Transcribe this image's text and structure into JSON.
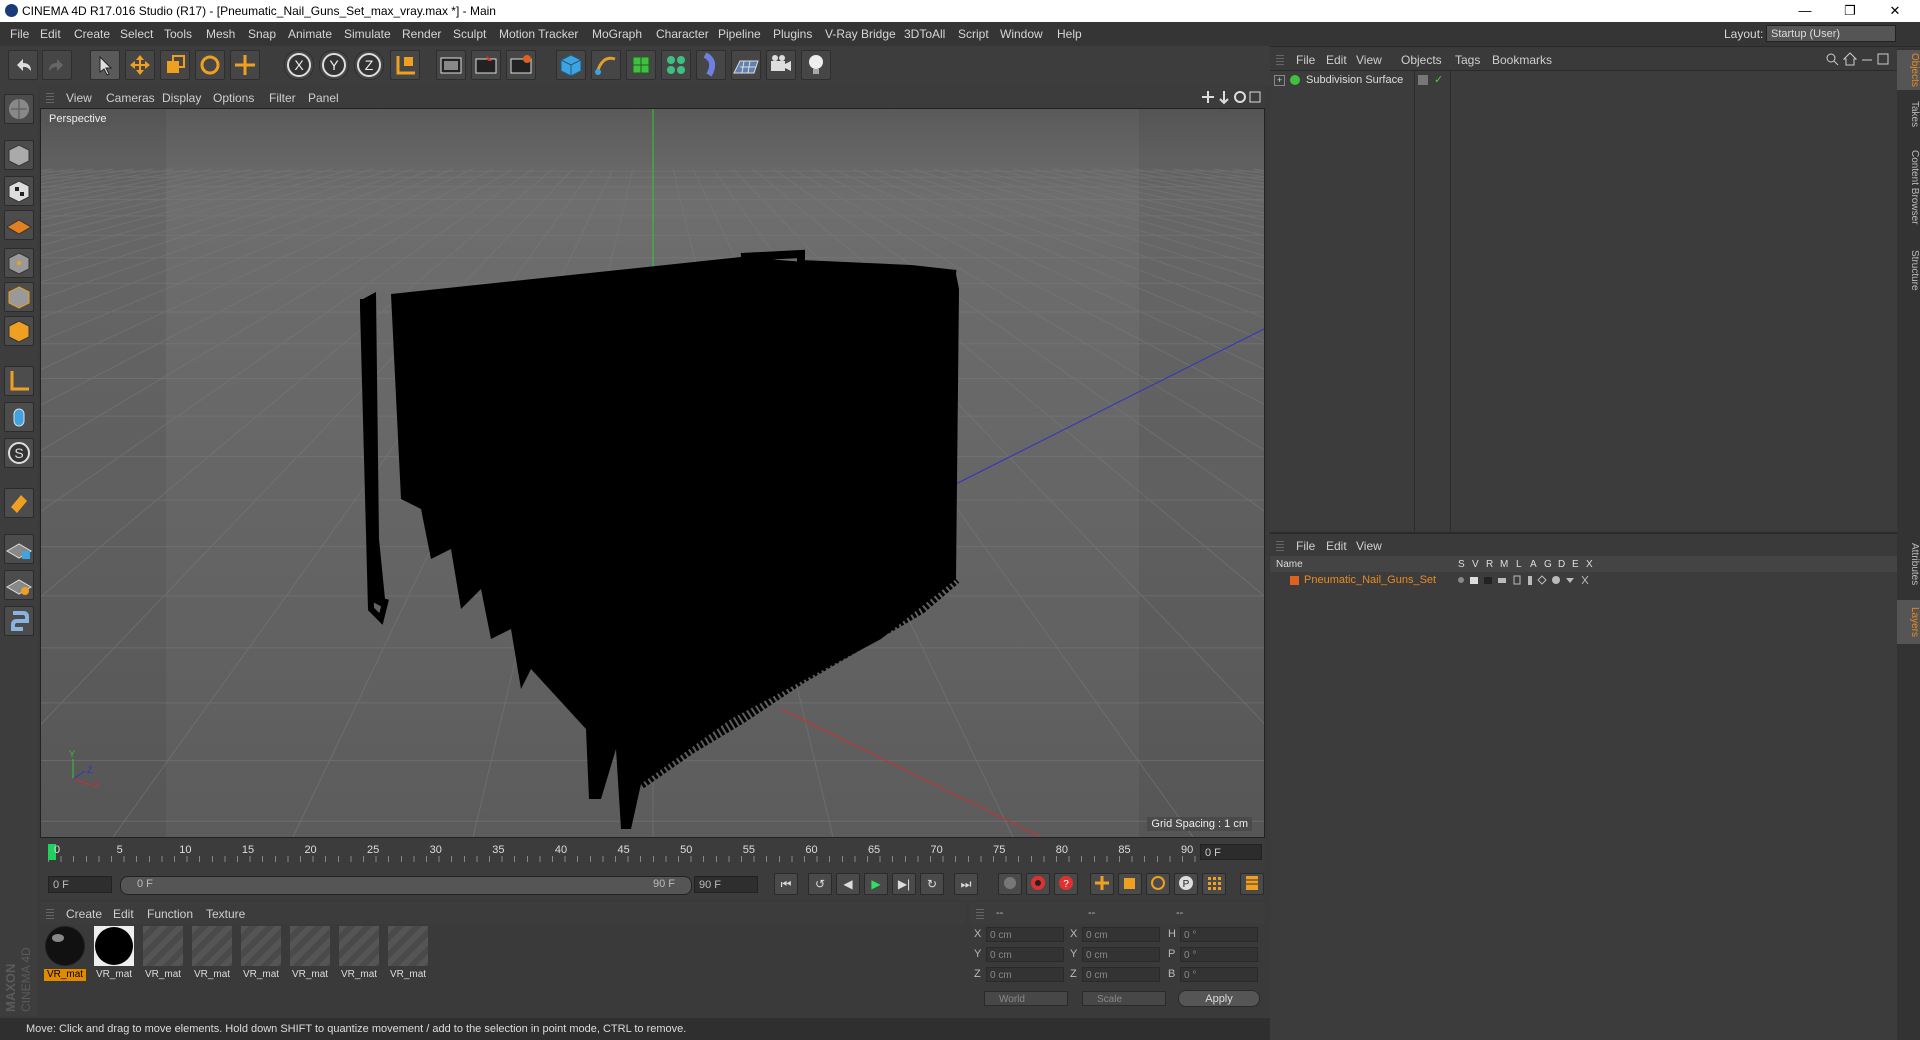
{
  "titlebar": {
    "title": "CINEMA 4D R17.016 Studio (R17) - [Pneumatic_Nail_Guns_Set_max_vray.max *] - Main",
    "minimize": "—",
    "restore": "❐",
    "close": "✕"
  },
  "menubar": {
    "items": [
      "File",
      "Edit",
      "Create",
      "Select",
      "Tools",
      "Mesh",
      "Snap",
      "Animate",
      "Simulate",
      "Render",
      "Sculpt",
      "Motion Tracker",
      "MoGraph",
      "Character",
      "Pipeline",
      "Plugins",
      "V-Ray Bridge",
      "3DToAll",
      "Script",
      "Window",
      "Help"
    ],
    "layout_label": "Layout:",
    "layout_value": "Startup (User)"
  },
  "toolbar": {
    "icons": [
      "undo-icon",
      "redo-icon",
      "select-arrow-icon",
      "move-icon",
      "scale-icon",
      "rotate-icon",
      "move-axis-icon",
      "x-axis-lock-icon",
      "y-axis-lock-icon",
      "z-axis-lock-icon",
      "coordinate-system-icon",
      "render-view-icon",
      "render-picture-viewer-icon",
      "render-settings-icon",
      "cube-primitive-icon",
      "spline-pen-icon",
      "subdivision-surface-icon",
      "mograph-cloner-icon",
      "deformer-icon",
      "floor-icon",
      "camera-icon",
      "light-icon"
    ],
    "xyz": [
      "X",
      "Y",
      "Z"
    ]
  },
  "left_toolbar": {
    "icons": [
      "make-editable-icon",
      "model-mode-icon",
      "texture-mode-icon",
      "workplane-icon",
      "points-mode-icon",
      "edges-mode-icon",
      "polygons-mode-icon",
      "axis-mode-icon",
      "tweak-mode-icon",
      "solo-mode-icon",
      "snap-icon",
      "lock-workplane-icon",
      "snap-settings-icon",
      "python-icon"
    ]
  },
  "viewport": {
    "menu": [
      "View",
      "Cameras",
      "Display",
      "Options",
      "Filter",
      "Panel"
    ],
    "label": "Perspective",
    "grid_spacing": "Grid Spacing : 1 cm",
    "axis_y": "Y",
    "axis_x": "X",
    "axis_z": "Z",
    "colors": {
      "background": "#5f5f5f",
      "floor": "#6a6a6a",
      "object": "#000000",
      "axis_x": "#c83232",
      "axis_y": "#32c832",
      "axis_z": "#3232c8"
    }
  },
  "timeline": {
    "ticks": [
      "0",
      "5",
      "10",
      "15",
      "20",
      "25",
      "30",
      "35",
      "40",
      "45",
      "50",
      "55",
      "60",
      "65",
      "70",
      "75",
      "80",
      "85",
      "90"
    ],
    "current_frame": "0 F",
    "start_field": "0 F",
    "range_start": "0 F",
    "range_end": "90 F",
    "end_field": "90 F"
  },
  "transport": {
    "buttons": [
      "goto-start-icon",
      "prev-key-icon",
      "prev-frame-icon",
      "play-icon",
      "next-frame-icon",
      "next-key-icon",
      "goto-end-icon"
    ],
    "glyphs": [
      "⏮",
      "↺",
      "◀",
      "▶",
      "▶|",
      "↻",
      "⏭"
    ]
  },
  "materials": {
    "menu": [
      "Create",
      "Edit",
      "Function",
      "Texture"
    ],
    "items": [
      "VR_mat",
      "VR_mat",
      "VR_mat",
      "VR_mat",
      "VR_mat",
      "VR_mat",
      "VR_mat",
      "VR_mat"
    ]
  },
  "coords": {
    "head": [
      "--",
      "--",
      "--"
    ],
    "rows": [
      {
        "a": "X",
        "av": "0 cm",
        "b": "X",
        "bv": "0 cm",
        "c": "H",
        "cv": "0 °"
      },
      {
        "a": "Y",
        "av": "0 cm",
        "b": "Y",
        "bv": "0 cm",
        "c": "P",
        "cv": "0 °"
      },
      {
        "a": "Z",
        "av": "0 cm",
        "b": "Z",
        "bv": "0 cm",
        "c": "B",
        "cv": "0 °"
      }
    ],
    "world": "World",
    "scale": "Scale",
    "apply": "Apply"
  },
  "status": {
    "text": "Move: Click and drag to move elements. Hold down SHIFT to quantize movement / add to the selection in point mode, CTRL to remove."
  },
  "branding": {
    "maxon": "MAXON",
    "cinema": "CINEMA 4D"
  },
  "objects_panel": {
    "menu": [
      "File",
      "Edit",
      "View",
      "Objects",
      "Tags",
      "Bookmarks"
    ],
    "object_name": "Subdivision Surface"
  },
  "layers_panel": {
    "menu": [
      "File",
      "Edit",
      "View"
    ],
    "columns": [
      "Name",
      "S",
      "V",
      "R",
      "M",
      "L",
      "A",
      "G",
      "D",
      "E",
      "X"
    ],
    "layer_name": "Pneumatic_Nail_Guns_Set",
    "layer_color": "#e06020"
  },
  "right_tabs": [
    "Objects",
    "Takes",
    "Content Browser",
    "Structure",
    "Attributes",
    "Layers"
  ]
}
